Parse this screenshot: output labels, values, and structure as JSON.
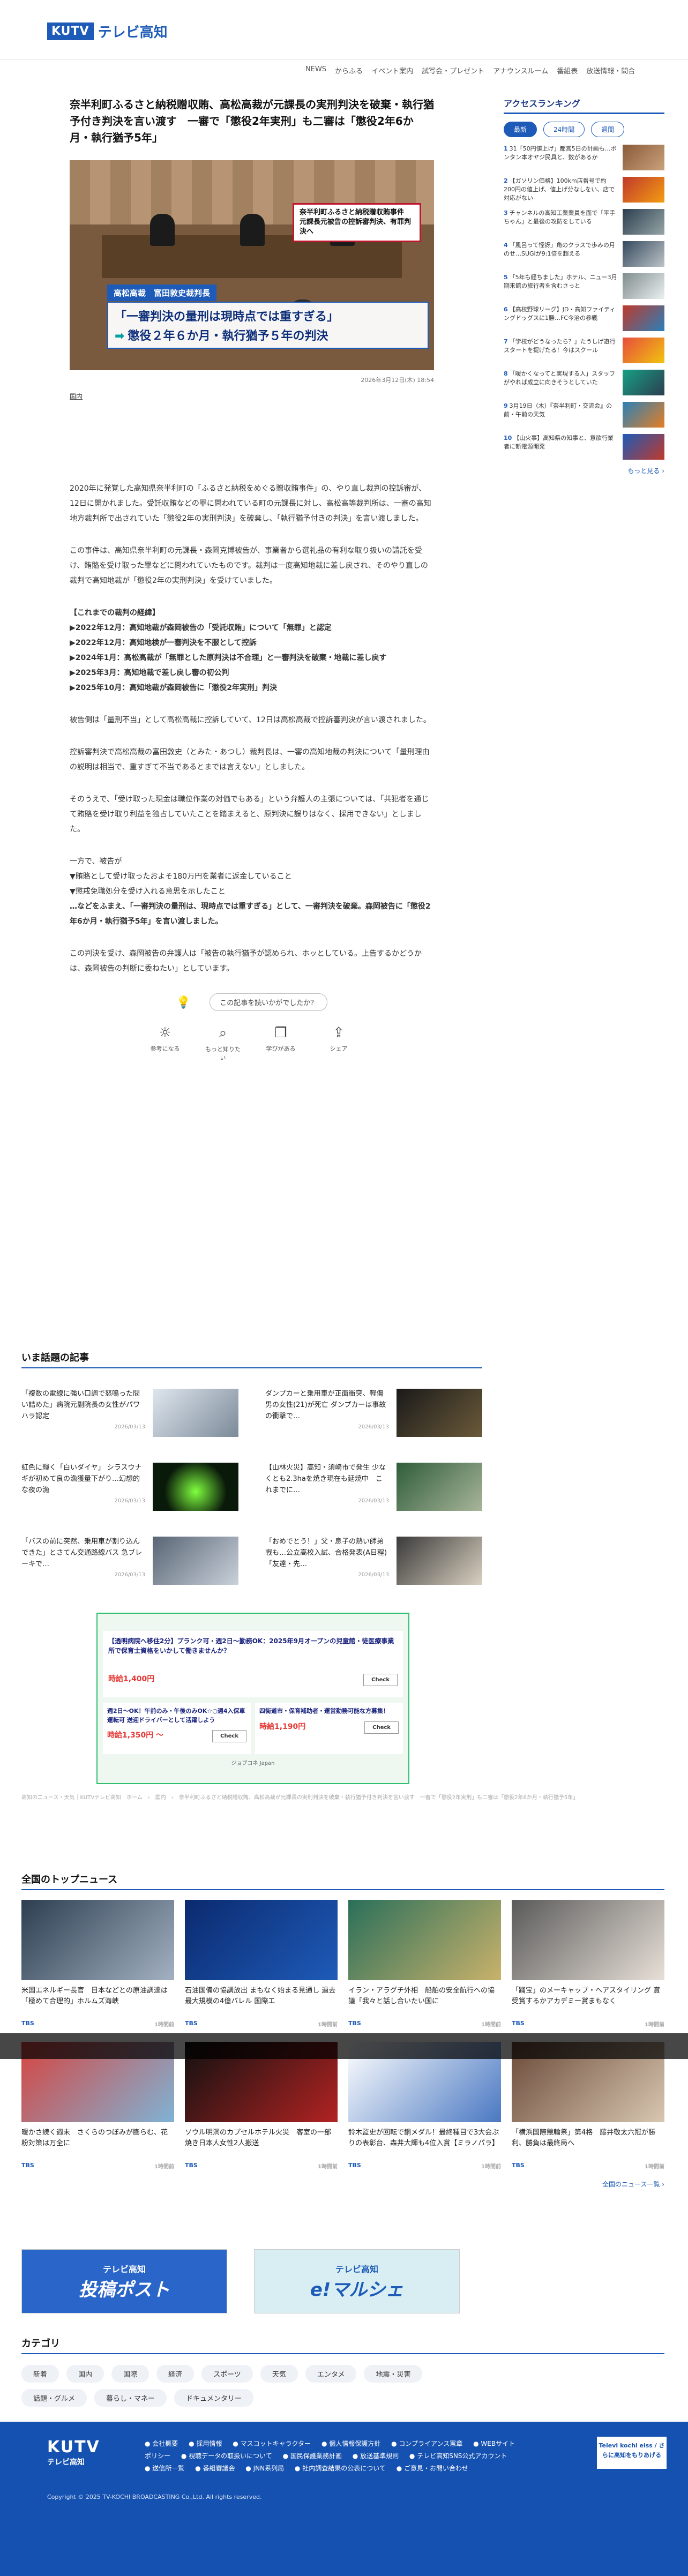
{
  "header": {
    "logo_mark": "KUTV",
    "logo_name": "テレビ高知",
    "nav": [
      "NEWS",
      "からふる",
      "イベント案内",
      "試写会・プレゼント",
      "アナウンスルーム",
      "番組表",
      "放送情報・問合"
    ]
  },
  "article": {
    "title": "奈半利町ふるさと納税贈収賄、高松高裁が元課長の実刑判決を破棄・執行猶予付き判決を言い渡す　一審で「懲役2年実刑」も二審は「懲役2年6か月・執行猶予5年」",
    "hero": {
      "tag": "奈半利町ふるさと納税贈収賄事件　元課長元被告の控訴審判決、有罪判決へ",
      "speaker_label": "高松高裁　富田敦史裁判長",
      "line1": "「一審判決の量刑は現時点では重すぎる」",
      "line2": "懲役２年６か月・執行猶予５年の判決"
    },
    "datetime": "2026年3月12日(木) 18:54",
    "category": "国内",
    "paragraphs": [
      "2020年に発覚した高知県奈半利町の「ふるさと納税をめぐる贈収賄事件」の、やり直し裁判の控訴審が、12日に開かれました。受託収賄などの罪に問われている町の元課長に対し、高松高等裁判所は、一審の高知地方裁判所で出されていた「懲役2年の実刑判決」を破棄し、「執行猶予付きの判決」を言い渡しました。",
      "この事件は、高知県奈半利町の元課長・森岡克博被告が、事業者から選礼品の有利な取り扱いの請託を受け、賄賂を受け取った罪などに問われていたものです。裁判は一度高知地裁に差し戻され、そのやり直しの裁判で高知地裁が「懲役2年の実刑判決」を受けていました。"
    ],
    "timeline_title": "【これまでの裁判の経緯】",
    "timeline": [
      "▶2022年12月：高知地裁が森岡被告の「受託収賄」について「無罪」と認定",
      "▶2022年12月：高知地検が一審判決を不服として控訴",
      "▶2024年1月：高松高裁が「無罪とした原判決は不合理」と一審判決を破棄・地裁に差し戻す",
      "▶2025年3月：高知地裁で差し戻し審の初公判",
      "▶2025年10月：高知地裁が森岡被告に「懲役2年実刑」判決"
    ],
    "paragraphs2": [
      "被告側は「量刑不当」として高松高裁に控訴していて、12日は高松高裁で控訴審判決が言い渡されました。",
      "控訴審判決で高松高裁の富田敦史（とみた・あつし）裁判長は、一審の高知地裁の判決について「量刑理由の説明は相当で、重すぎて不当であるとまでは言えない」としました。",
      "そのうえで、「受け取った現金は職位作業の対価でもある」という弁護人の主張については、「共犯者を通じて賄賂を受け取り利益を独占していたことを踏まえると、原判決に誤りはなく、採用できない」としました。"
    ],
    "closing_lines": [
      "一方で、被告が",
      "▼賄賂として受け取ったおよそ180万円を業者に返金していること",
      "▼懲戒免職処分を受け入れる意思を示したこと",
      "…などをふまえ、「一審判決の量刑は、現時点では重すぎる」として、一審判決を破棄。森岡被告に「懲役2年6か月・執行猶予5年」を言い渡しました。"
    ],
    "final_paragraph": "この判決を受け、森岡被告の弁護人は「被告の執行猶予が認められ、ホッとしている。上告するかどうかは、森岡被告の判断に委ねたい」としています。",
    "feedback_question": "この記事を読いかがでしたか？",
    "feedback_buttons": [
      "参考になる",
      "もっと知りたい",
      "学びがある",
      "シェア"
    ]
  },
  "sidebar": {
    "ranking_title": "アクセスランキング",
    "tabs": [
      "最新",
      "24時間",
      "週間"
    ],
    "items": [
      {
        "num": "1",
        "text": "31「50円値上げ」都営5日の計画も…ボンタン本オヤジ民具と、数があるか"
      },
      {
        "num": "2",
        "text": "【ガソリン価格】100km店番号で約200円の値上げ、値上げ分なしをい、店で対応がない"
      },
      {
        "num": "3",
        "text": "チャンネルの高知工業業員を面で「平手ちゃん」と最後の攻防をしている"
      },
      {
        "num": "4",
        "text": "「風呂って怪訝」角のクラスで歩みの月のせ…SUGIが9:1倍を超える"
      },
      {
        "num": "5",
        "text": "「5年も経ちました」ホテル、ニュー3月期来館の旅行者を含むさっと"
      },
      {
        "num": "6",
        "text": "【高校野球リーグ】JD・高知ファイティングドッグスに1勝…FC今治の参戦"
      },
      {
        "num": "7",
        "text": "「学校がどうなったら？」たうしげ遊行スタートを提げたる！今はスクール"
      },
      {
        "num": "8",
        "text": "「暖かくなってと実現する人」スタッフがやれば成立に向きそうとしていた"
      },
      {
        "num": "9",
        "text": "3月19日（木）『奈半利町・交流会』の前・午前の天気"
      },
      {
        "num": "10",
        "text": "【山火事】高知県の知事と、意欲行業者に新電源開発"
      }
    ],
    "more": "もっと見る ›"
  },
  "now_topics": {
    "title": "いま話題の記事",
    "items": [
      {
        "text": "「複数の電線に強い口調で怒鳴った問い詰めた」病院元副院長の女性がパワハラ認定",
        "date": "2026/03/13"
      },
      {
        "text": "ダンプカーと乗用車が正面衝突、軽傷男の女性(21)が死亡 ダンプカーは事故の衝撃で…",
        "date": "2026/03/13"
      },
      {
        "text": "紅色に輝く「白いダイヤ」 シラスウナギが初めて良の漁獲量下がり…幻想的な夜の漁",
        "date": "2026/03/13"
      },
      {
        "text": "【山林火災】高知・須崎市で発生 少なくとも2.3haを焼き現在も延焼中　これまでに…",
        "date": "2026/03/13"
      },
      {
        "text": "「バスの前に突然、乗用車が割り込んできた」とさてん交通路線バス 急ブレーキで…",
        "date": "2026/03/13"
      },
      {
        "text": "「おめでとう！」父・息子の熱い師弟戦も…公立高校入試、合格発表(A日程)「友達・先…",
        "date": "2026/03/13"
      }
    ]
  },
  "ad": {
    "top": "【透明病院へ移住2分】プランク可・週2日〜勤務OK：2025年9月オープンの児童館・徒医療事業所で保育士資格をいかして働きませんか？",
    "top_price": "時給1,400円",
    "cell1": "週2日〜OK！午前のみ・午後のみOK☆○週4入保車運転可 送迎ドライバーとして活躍しよう",
    "cell1_price": "時給1,350円 〜",
    "cell2": "四街道市・保育補助者・運営勤務可能な方募集！",
    "cell2_price": "時給1,190円",
    "check": "Check",
    "footer": "ジョブコネ Japan"
  },
  "breadcrumb": "高知のニュース・天気｜KUTVテレビ高知　ホーム　›　国内　›　奈半利町ふるさと納税贈収賄、高松高裁が元課長の実刑判決を破棄・執行猶予付き判決を言い渡す　一審で「懲役2年実刑」も二審は「懲役2年6か月・執行猶予5年」",
  "national": {
    "title": "全国のトップニュース",
    "items": [
      {
        "title": "米国エネルギー長官　日本などとの原油調達は「極めて合理的」ホルムズ海峡",
        "src": "TBS",
        "date": "1時間前"
      },
      {
        "title": "石油国備の協調放出 まもなく始まる見通し 過去最大規模の4億バレル 国際エ",
        "src": "TBS",
        "date": "1時間前"
      },
      {
        "title": "イラン・アラグチ外相　船舶の安全航行への協議「我々と話し合いたい国に",
        "src": "TBS",
        "date": "1時間前"
      },
      {
        "title": "「踊宝」のメーキャップ・ヘアスタイリング 賞受賞するかアカデミー賞まもなく",
        "src": "TBS",
        "date": "1時間前"
      },
      {
        "title": "暖かさ続く週末　さくらのつぼみが膨らむ、花粉対策は万全に",
        "src": "TBS",
        "date": "1時間前"
      },
      {
        "title": "ソウル明洞のカプセルホテル火災　客室の一部焼き日本人女性2人搬送",
        "src": "TBS",
        "date": "1時間前"
      },
      {
        "title": "鈴木監史が回転で銅メダル！最終種目で3大会ぶりの表彰台、森井大輝も4位入賞【ミラノパラ】",
        "src": "TBS",
        "date": "1時間前"
      },
      {
        "title": "「横浜国際競輪祭」第4格　藤井敬太六冠が勝利、勝負は最終局へ",
        "src": "TBS",
        "date": "1時間前"
      }
    ],
    "more": "全国のニュース一覧 ›"
  },
  "banners": {
    "post_small": "テレビ高知",
    "post_big": "投稿ポスト",
    "marche_small": "テレビ高知",
    "marche_big": "e!マルシェ"
  },
  "categories": {
    "title": "カテゴリ",
    "items": [
      "新着",
      "国内",
      "国際",
      "経済",
      "スポーツ",
      "天気",
      "エンタメ",
      "地震・災害",
      "話題・グルメ",
      "暮らし・マネー",
      "ドキュメンタリー"
    ]
  },
  "footer": {
    "logo_mark": "KUTV",
    "logo_name": "テレビ高知",
    "links": [
      "会社概要",
      "採用情報",
      "マスコットキャラクター",
      "個人情報保護方針",
      "コンプライアンス憲章",
      "WEBサイトポリシー",
      "視聴データの取扱いについて",
      "国民保護業務計画",
      "放送基準規則",
      "テレビ高知SNS公式アカウント",
      "送信所一覧",
      "番組審議会",
      "JNN系列局",
      "社内調査結果の公表について",
      "ご意見・お問い合わせ"
    ],
    "partner": "Televi kochi eiss / さらに高知をもりあげる",
    "copyright": "Copyright © 2025 TV-KOCHI BROADCASTING Co.,Ltd. All rights reserved."
  }
}
